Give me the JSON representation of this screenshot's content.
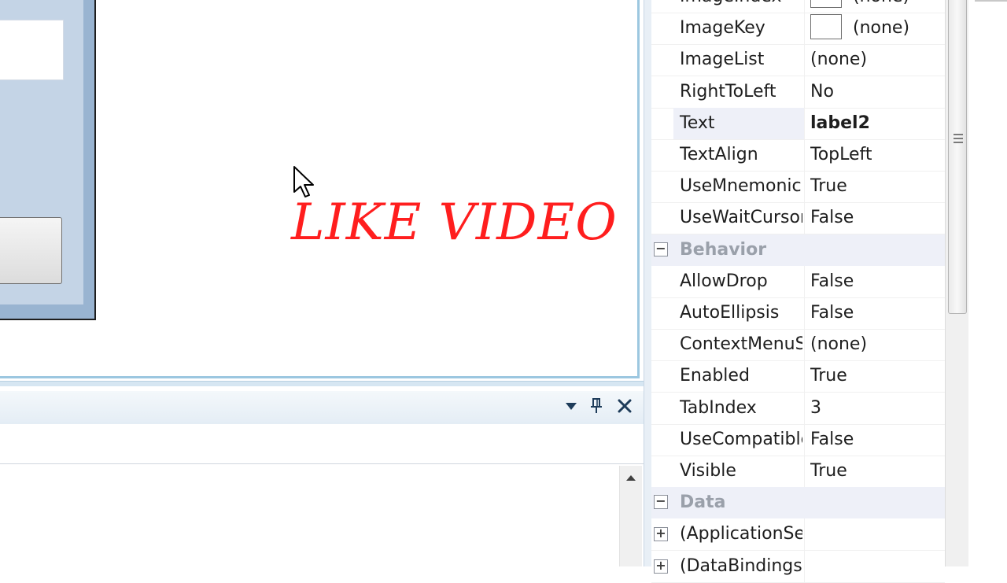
{
  "designer": {
    "label_text": "LIKE VIDEO",
    "label_color": "#ff1e1e"
  },
  "tool_window": {
    "icons": [
      "dropdown-arrow-icon",
      "pin-icon",
      "close-icon"
    ]
  },
  "properties": {
    "rows": [
      {
        "type": "prop",
        "name": "ImageIndex",
        "value": "(none)",
        "swatch": true
      },
      {
        "type": "prop",
        "name": "ImageKey",
        "value": "(none)",
        "swatch": true
      },
      {
        "type": "prop",
        "name": "ImageList",
        "value": "(none)"
      },
      {
        "type": "prop",
        "name": "RightToLeft",
        "value": "No"
      },
      {
        "type": "prop",
        "name": "Text",
        "value": "label2",
        "selected": true
      },
      {
        "type": "prop",
        "name": "TextAlign",
        "value": "TopLeft"
      },
      {
        "type": "prop",
        "name": "UseMnemonic",
        "value": "True"
      },
      {
        "type": "prop",
        "name": "UseWaitCursor",
        "value": "False"
      },
      {
        "type": "category",
        "name": "Behavior",
        "expander": "−"
      },
      {
        "type": "prop",
        "name": "AllowDrop",
        "value": "False"
      },
      {
        "type": "prop",
        "name": "AutoEllipsis",
        "value": "False"
      },
      {
        "type": "prop",
        "name": "ContextMenuS",
        "value": "(none)"
      },
      {
        "type": "prop",
        "name": "Enabled",
        "value": "True"
      },
      {
        "type": "prop",
        "name": "TabIndex",
        "value": "3"
      },
      {
        "type": "prop",
        "name": "UseCompatible",
        "value": "False"
      },
      {
        "type": "prop",
        "name": "Visible",
        "value": "True"
      },
      {
        "type": "category",
        "name": "Data",
        "expander": "−"
      },
      {
        "type": "prop",
        "name": "(ApplicationSe",
        "value": "",
        "expander": "+"
      },
      {
        "type": "prop",
        "name": "(DataBindings)",
        "value": "",
        "expander": "+"
      }
    ]
  }
}
